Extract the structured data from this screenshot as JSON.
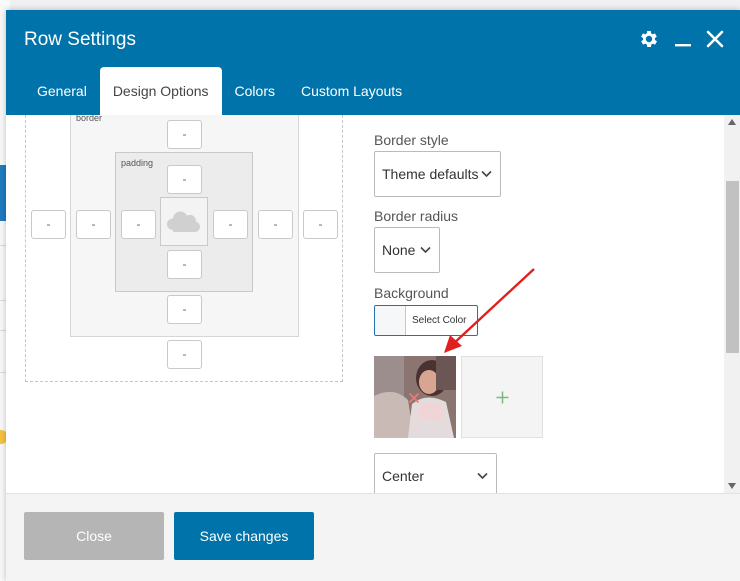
{
  "header": {
    "title": "Row Settings"
  },
  "tabs": [
    {
      "label": "General"
    },
    {
      "label": "Design Options"
    },
    {
      "label": "Colors"
    },
    {
      "label": "Custom Layouts"
    }
  ],
  "box_model": {
    "border_label": "border",
    "padding_label": "padding",
    "placeholder": "-"
  },
  "fields": {
    "border_style": {
      "label": "Border style",
      "value": "Theme defaults"
    },
    "border_radius": {
      "label": "Border radius",
      "value": "None"
    },
    "background": {
      "label": "Background",
      "select_color": "Select Color"
    },
    "position": {
      "value": "Center"
    }
  },
  "footer": {
    "close_label": "Close",
    "save_label": "Save changes"
  },
  "colors": {
    "brand": "#0073aa",
    "close_button": "#b5b5b5",
    "arrow": "#e02020"
  }
}
